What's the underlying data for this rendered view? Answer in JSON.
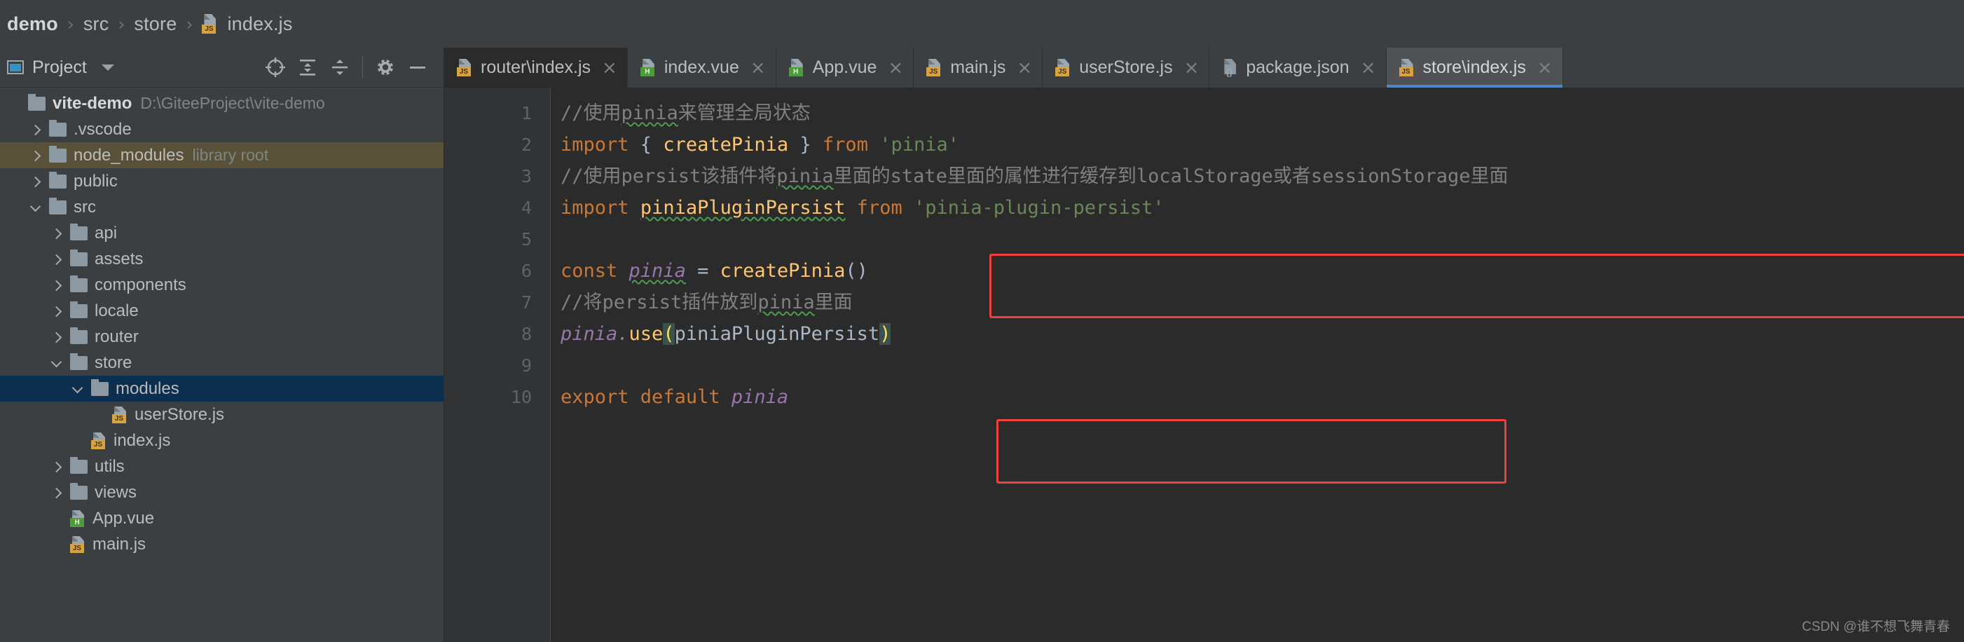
{
  "breadcrumb": {
    "name": "breadcrumb",
    "items": [
      {
        "label": "demo",
        "icon": ""
      },
      {
        "label": "src",
        "icon": ""
      },
      {
        "label": "store",
        "icon": ""
      },
      {
        "label": "index.js",
        "icon": "js-file-icon"
      }
    ],
    "separator": "›"
  },
  "project_panel": {
    "title": "Project",
    "title_caret": "chevron-down-icon",
    "tools": [
      {
        "name": "locate-icon",
        "tooltip": "Select Opened File"
      },
      {
        "name": "expand-all-icon",
        "tooltip": "Expand All"
      },
      {
        "name": "collapse-all-icon",
        "tooltip": "Collapse All"
      },
      {
        "name": "settings-gear-icon",
        "tooltip": "Settings"
      },
      {
        "name": "hide-icon",
        "tooltip": "Hide"
      }
    ],
    "tree": [
      {
        "label": "vite-demo",
        "sub": "D:\\GiteeProject\\vite-demo",
        "kind": "folder",
        "arrow": "none",
        "indent": 0,
        "state": "root"
      },
      {
        "label": ".vscode",
        "sub": "",
        "kind": "folder",
        "arrow": "right",
        "indent": 1,
        "state": "normal"
      },
      {
        "label": "node_modules",
        "sub": "library root",
        "kind": "folder",
        "arrow": "right",
        "indent": 1,
        "state": "library"
      },
      {
        "label": "public",
        "sub": "",
        "kind": "folder",
        "arrow": "right",
        "indent": 1,
        "state": "normal"
      },
      {
        "label": "src",
        "sub": "",
        "kind": "folder",
        "arrow": "down",
        "indent": 1,
        "state": "normal"
      },
      {
        "label": "api",
        "sub": "",
        "kind": "folder",
        "arrow": "right",
        "indent": 2,
        "state": "normal"
      },
      {
        "label": "assets",
        "sub": "",
        "kind": "folder",
        "arrow": "right",
        "indent": 2,
        "state": "normal"
      },
      {
        "label": "components",
        "sub": "",
        "kind": "folder",
        "arrow": "right",
        "indent": 2,
        "state": "normal"
      },
      {
        "label": "locale",
        "sub": "",
        "kind": "folder",
        "arrow": "right",
        "indent": 2,
        "state": "normal"
      },
      {
        "label": "router",
        "sub": "",
        "kind": "folder",
        "arrow": "right",
        "indent": 2,
        "state": "normal"
      },
      {
        "label": "store",
        "sub": "",
        "kind": "folder",
        "arrow": "down",
        "indent": 2,
        "state": "normal"
      },
      {
        "label": "modules",
        "sub": "",
        "kind": "folder",
        "arrow": "down",
        "indent": 3,
        "state": "selected"
      },
      {
        "label": "userStore.js",
        "sub": "",
        "kind": "js",
        "arrow": "none",
        "indent": 4,
        "state": "normal"
      },
      {
        "label": "index.js",
        "sub": "",
        "kind": "js",
        "arrow": "none",
        "indent": 3,
        "state": "normal"
      },
      {
        "label": "utils",
        "sub": "",
        "kind": "folder",
        "arrow": "right",
        "indent": 2,
        "state": "normal"
      },
      {
        "label": "views",
        "sub": "",
        "kind": "folder",
        "arrow": "right",
        "indent": 2,
        "state": "normal"
      },
      {
        "label": "App.vue",
        "sub": "",
        "kind": "vue",
        "arrow": "none",
        "indent": 2,
        "state": "normal"
      },
      {
        "label": "main.js",
        "sub": "",
        "kind": "js",
        "arrow": "none",
        "indent": 2,
        "state": "normal"
      }
    ]
  },
  "editor": {
    "tabs": [
      {
        "label": "router\\index.js",
        "kind": "js",
        "active": false,
        "dark": true,
        "close": "×"
      },
      {
        "label": "index.vue",
        "kind": "vue",
        "active": false,
        "dark": false,
        "close": "×"
      },
      {
        "label": "App.vue",
        "kind": "vue",
        "active": false,
        "dark": false,
        "close": "×"
      },
      {
        "label": "main.js",
        "kind": "js",
        "active": false,
        "dark": false,
        "close": "×"
      },
      {
        "label": "userStore.js",
        "kind": "js",
        "active": false,
        "dark": false,
        "close": "×"
      },
      {
        "label": "package.json",
        "kind": "json",
        "active": false,
        "dark": false,
        "close": "×"
      },
      {
        "label": "store\\index.js",
        "kind": "js",
        "active": true,
        "dark": false,
        "close": "×"
      }
    ],
    "line_numbers": [
      "1",
      "2",
      "3",
      "4",
      "5",
      "6",
      "7",
      "8",
      "9",
      "10"
    ],
    "lines": [
      {
        "n": 1,
        "text": "//使用pinia来管理全局状态"
      },
      {
        "n": 2,
        "text": "import { createPinia } from 'pinia'"
      },
      {
        "n": 3,
        "text": "//使用persist该插件将pinia里面的state里面的属性进行缓存到localStorage或者sessionStorage里面"
      },
      {
        "n": 4,
        "text": "import piniaPluginPersist from 'pinia-plugin-persist'"
      },
      {
        "n": 5,
        "text": ""
      },
      {
        "n": 6,
        "text": "const pinia = createPinia()"
      },
      {
        "n": 7,
        "text": "//将persist插件放到pinia里面"
      },
      {
        "n": 8,
        "text": "pinia.use(piniaPluginPersist)"
      },
      {
        "n": 9,
        "text": ""
      },
      {
        "n": 10,
        "text": "export default pinia"
      }
    ],
    "tokens": {
      "l1_comment_a": "//使用",
      "l1_comment_squig": "pinia",
      "l1_comment_b": "来管理全局状态",
      "l2_import": "import",
      "l2_brace_open": " { ",
      "l2_fn": "createPinia",
      "l2_brace_close": " } ",
      "l2_from": "from",
      "l2_str": " 'pinia'",
      "l3_a": "//使用persist该插件将",
      "l3_squig": "pinia",
      "l3_b": "里面的state里面的属性进行缓存到localStorage或者sessionStorage里面",
      "l4_import": "import",
      "l4_id": "piniaPluginPersist",
      "l4_from": " from",
      "l4_str": " 'pinia-plugin-persist'",
      "l6_const": "const",
      "l6_var": "pinia",
      "l6_eq": " = ",
      "l6_fn": "createPinia",
      "l6_parens": "()",
      "l7_a": "//将persist插件放到",
      "l7_squig": "pinia",
      "l7_b": "里面",
      "l8_var": "pinia",
      "l8_dot": ".",
      "l8_fn": "use",
      "l8_lp": "(",
      "l8_arg": "piniaPluginPersist",
      "l8_rp": ")",
      "l10_export": "export",
      "l10_default": " default ",
      "l10_var": "pinia"
    },
    "annotations": [
      {
        "name": "red-highlight-box-import",
        "lines": "3-4"
      },
      {
        "name": "red-highlight-box-use",
        "lines": "7-8"
      }
    ]
  },
  "watermark": "CSDN @谁不想飞舞青春",
  "colors": {
    "accent_blue": "#4a88c7",
    "selection_blue": "#0d2f4f",
    "library_olive": "#5a5238",
    "annotation_red": "#f0413f",
    "keyword_orange": "#cc7832",
    "string_green": "#6a8759",
    "function_yellow": "#ffc66d",
    "variable_purple": "#9876aa",
    "comment_gray": "#808080",
    "panel_bg": "#3c3f41",
    "editor_bg": "#2b2b2b"
  }
}
